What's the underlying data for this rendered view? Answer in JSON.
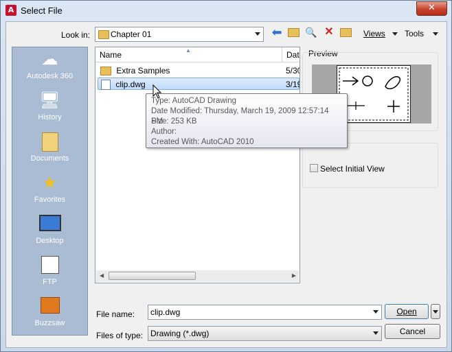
{
  "window": {
    "title": "Select File",
    "app_icon_letter": "A",
    "close_symbol": "✕"
  },
  "lookin": {
    "label": "Look in:",
    "value": "Chapter 01"
  },
  "toolbar": {
    "views_label": "Views",
    "tools_label": "Tools"
  },
  "places": [
    {
      "label": "Autodesk 360",
      "icon": "cloud-icon"
    },
    {
      "label": "History",
      "icon": "history-icon"
    },
    {
      "label": "Documents",
      "icon": "documents-folder-icon"
    },
    {
      "label": "Favorites",
      "icon": "favorites-folder-icon"
    },
    {
      "label": "Desktop",
      "icon": "desktop-icon"
    },
    {
      "label": "FTP",
      "icon": "ftp-icon"
    },
    {
      "label": "Buzzsaw",
      "icon": "buzzsaw-icon"
    }
  ],
  "filelist": {
    "columns": {
      "name": "Name",
      "date": "Date"
    },
    "rows": [
      {
        "name": "Extra Samples",
        "date": "5/30",
        "icon": "folder-icon"
      },
      {
        "name": "clip.dwg",
        "date": "3/19",
        "icon": "dwg-file-icon",
        "selected": true
      }
    ]
  },
  "tooltip": {
    "type": "Type: AutoCAD Drawing",
    "modified": "Date Modified: Thursday, March 19, 2009 12:57:14 PM",
    "size": "Size: 253 KB",
    "author": "Author:",
    "created_with": "Created With: AutoCAD 2010"
  },
  "preview": {
    "label": "Preview"
  },
  "initial_view": {
    "label": "Select Initial View",
    "checked": false
  },
  "filename": {
    "label": "File name:",
    "value": "clip.dwg"
  },
  "filetype": {
    "label": "Files of type:",
    "value": "Drawing (*.dwg)"
  },
  "buttons": {
    "open": "Open",
    "cancel": "Cancel"
  }
}
